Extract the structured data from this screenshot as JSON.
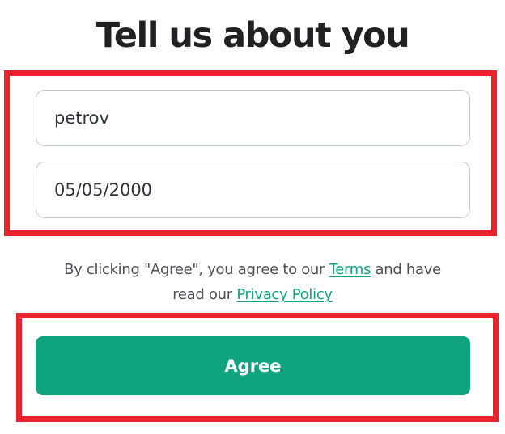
{
  "page": {
    "title": "Tell us about you"
  },
  "form": {
    "name_value": "petrov",
    "birthday_value": "05/05/2000"
  },
  "legal": {
    "text_before": "By clicking \"Agree\", you agree to our ",
    "terms_link": "Terms",
    "text_middle": " and have",
    "text_second_line": "read our ",
    "privacy_link": "Privacy Policy"
  },
  "actions": {
    "agree_label": "Agree"
  },
  "colors": {
    "accent": "#10a37f",
    "highlight": "#e8232d",
    "field_border": "#c2c8d0"
  }
}
